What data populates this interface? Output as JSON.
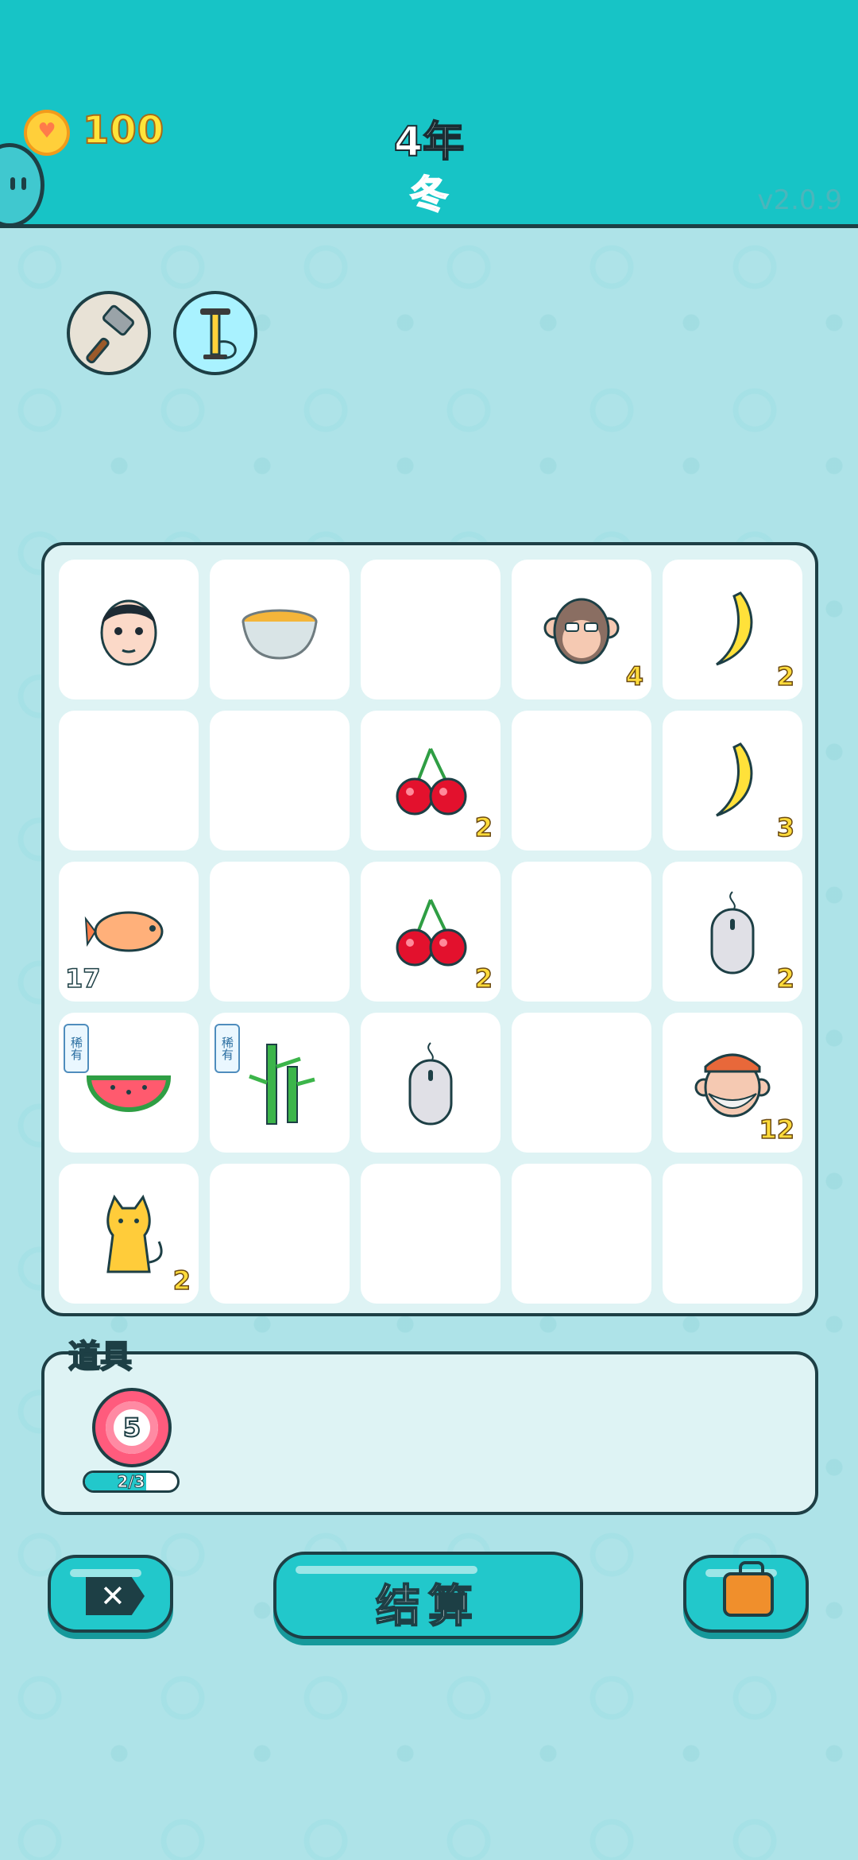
{
  "header": {
    "coins": "100",
    "year": "4年",
    "season": "冬",
    "version": "v2.0.9"
  },
  "tools": [
    {
      "name": "hammer-icon"
    },
    {
      "name": "air-pump-icon"
    }
  ],
  "board": {
    "rows": [
      [
        {
          "item": "man-face-icon",
          "count": ""
        },
        {
          "item": "soup-bowl-icon",
          "count": ""
        },
        {
          "item": "",
          "count": ""
        },
        {
          "item": "old-monkey-icon",
          "count": "4"
        },
        {
          "item": "banana-icon",
          "count": "2"
        }
      ],
      [
        {
          "item": "",
          "count": ""
        },
        {
          "item": "",
          "count": ""
        },
        {
          "item": "cherry-icon",
          "count": "2"
        },
        {
          "item": "",
          "count": ""
        },
        {
          "item": "banana-icon",
          "count": "3"
        }
      ],
      [
        {
          "item": "goldfish-icon",
          "count": "17"
        },
        {
          "item": "",
          "count": ""
        },
        {
          "item": "cherry-icon",
          "count": "2"
        },
        {
          "item": "",
          "count": ""
        },
        {
          "item": "computer-mouse-icon",
          "count": "2"
        }
      ],
      [
        {
          "item": "watermelon-icon",
          "count": "",
          "badge": "稀有"
        },
        {
          "item": "bamboo-icon",
          "count": "",
          "badge": "稀有"
        },
        {
          "item": "computer-mouse-icon",
          "count": ""
        },
        {
          "item": "",
          "count": ""
        },
        {
          "item": "old-man-cap-icon",
          "count": "12"
        }
      ],
      [
        {
          "item": "cat-icon",
          "count": "2"
        },
        {
          "item": "",
          "count": ""
        },
        {
          "item": "",
          "count": ""
        },
        {
          "item": "",
          "count": ""
        },
        {
          "item": "",
          "count": ""
        }
      ]
    ]
  },
  "props": {
    "title": "道具",
    "items": [
      {
        "name": "target-icon",
        "value": "5",
        "progress_text": "2/3",
        "progress": 0.6667
      }
    ]
  },
  "buttons": {
    "exit_icon": "close-x-icon",
    "settle_label": "结算",
    "bag_icon": "briefcase-icon"
  },
  "colors": {
    "header_bg": "#17c4c6",
    "page_bg": "#aee3e8",
    "accent": "#22c8cb",
    "count_yellow": "#ffdb3a",
    "season_pink": "#ff5a8c"
  }
}
